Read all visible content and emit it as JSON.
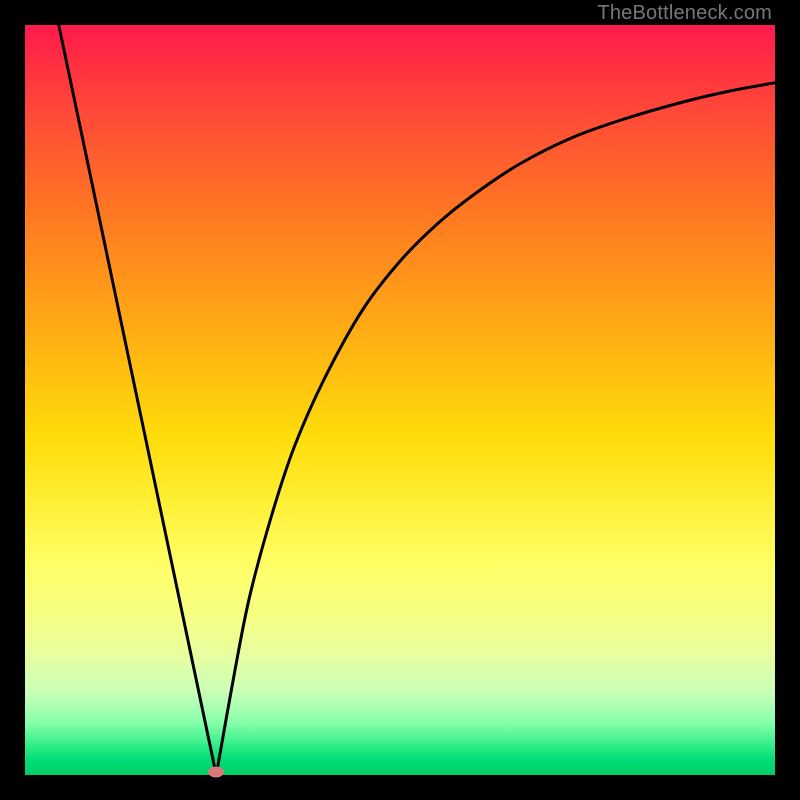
{
  "attribution": "TheBottleneck.com",
  "chart_data": {
    "type": "line",
    "title": "",
    "xlabel": "",
    "ylabel": "",
    "xlim": [
      0,
      100
    ],
    "ylim": [
      0,
      100
    ],
    "grid": false,
    "legend": false,
    "series": [
      {
        "name": "left-branch",
        "x": [
          4.5,
          25.5
        ],
        "y": [
          100,
          0
        ],
        "style": "line"
      },
      {
        "name": "right-branch",
        "x": [
          25.5,
          28,
          30,
          33,
          36,
          40,
          45,
          50,
          55,
          60,
          66,
          73,
          80,
          88,
          94,
          100
        ],
        "y": [
          0,
          14,
          24,
          35,
          44,
          53,
          62,
          68.5,
          73.5,
          77.5,
          81.5,
          85,
          87.5,
          89.8,
          91.2,
          92.3
        ],
        "style": "curve"
      }
    ],
    "minimum_point": {
      "x": 25.5,
      "y": 0
    },
    "background_gradient": {
      "top": "#ff1a4d",
      "bottom": "#00cc66",
      "meaning": "red-to-green performance/bottleneck scale"
    }
  }
}
